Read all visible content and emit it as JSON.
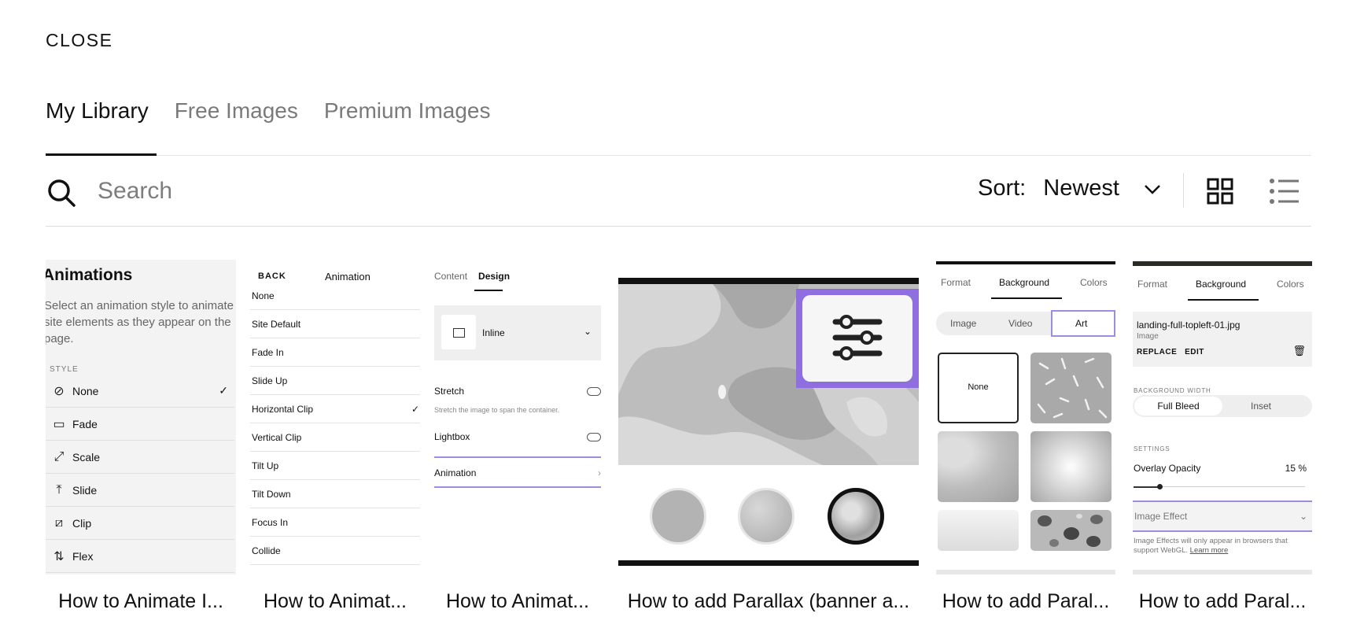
{
  "header": {
    "close_label": "CLOSE"
  },
  "tabs": [
    {
      "label": "My Library",
      "active": true
    },
    {
      "label": "Free Images",
      "active": false
    },
    {
      "label": "Premium Images",
      "active": false
    }
  ],
  "toolbar": {
    "search_placeholder": "Search",
    "sort_label": "Sort:",
    "sort_value": "Newest",
    "icons": [
      "search-icon",
      "chevron-down-icon",
      "grid-view-icon",
      "list-view-icon"
    ]
  },
  "cards": [
    {
      "title": "How to Animate I...",
      "thumb": {
        "heading": "Animations",
        "description": "Select an animation style to animate site elements as they appear on the page.",
        "section_label": "STYLE",
        "items": [
          "None",
          "Fade",
          "Scale",
          "Slide",
          "Clip",
          "Flex"
        ]
      }
    },
    {
      "title": "How to Animat...",
      "thumb": {
        "back": "BACK",
        "heading": "Animation",
        "items": [
          "None",
          "Site Default",
          "Fade In",
          "Slide Up",
          "Horizontal Clip",
          "Vertical Clip",
          "Tilt Up",
          "Tilt Down",
          "Focus In",
          "Collide"
        ]
      }
    },
    {
      "title": "How to Animat...",
      "thumb": {
        "tab_content": "Content",
        "tab_design": "Design",
        "layout_value": "Inline",
        "stretch_label": "Stretch",
        "stretch_hint": "Stretch the image to span the container.",
        "lightbox_label": "Lightbox",
        "animation_label": "Animation"
      }
    },
    {
      "title": "How to add Parallax (banner a..."
    },
    {
      "title": "How to add Paral...",
      "thumb": {
        "tabs": [
          "Format",
          "Background",
          "Colors"
        ],
        "segments": [
          "Image",
          "Video",
          "Art"
        ],
        "none_label": "None"
      }
    },
    {
      "title": "How to add Paral...",
      "thumb": {
        "tabs": [
          "Format",
          "Background",
          "Colors"
        ],
        "file_name": "landing-full-topleft-01.jpg",
        "file_type": "Image",
        "file_actions": "REPLACE   EDIT",
        "bg_width_label": "BACKGROUND WIDTH",
        "bg_width_on": "Full Bleed",
        "bg_width_off": "Inset",
        "settings_label": "SETTINGS",
        "opacity_label": "Overlay Opacity",
        "opacity_value": "15 %",
        "opacity": 0.15,
        "effect_label": "Image Effect",
        "effect_hint": "Image Effects will only appear in browsers that support WebGL.",
        "learn_more": "Learn more"
      }
    }
  ],
  "colors": {
    "accent": "#9b8ee0",
    "text": "#111111",
    "muted": "#7a7a7a"
  }
}
